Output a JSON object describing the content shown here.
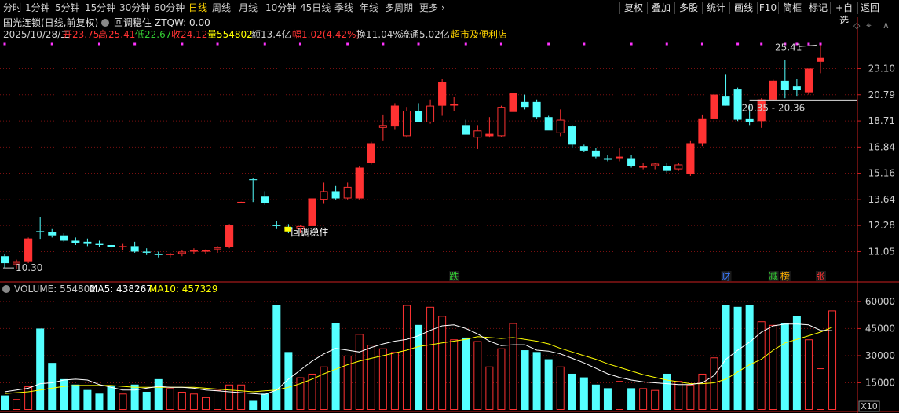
{
  "toolbar": {
    "periods": [
      "分时",
      "1分钟",
      "5分钟",
      "15分钟",
      "30分钟",
      "60分钟",
      "日线",
      "周线",
      "月线",
      "10分钟",
      "45日线",
      "季线",
      "年线",
      "多周期",
      "更多"
    ],
    "active_period": "日线",
    "more_arrow": "›",
    "right_buttons": [
      "复权",
      "叠加",
      "多股",
      "统计",
      "画线",
      "F10",
      "简框",
      "标记",
      "+自选",
      "返回"
    ]
  },
  "header": {
    "stock_title": "国光连锁(日线,前复权)",
    "indicator_name": "回调稳住",
    "indicator_value": "ZTQW: 0.00",
    "info": {
      "date": "2025/10/28/二",
      "open_label": "开",
      "open": "23.75",
      "high_label": "高",
      "high": "25.41",
      "low_label": "低",
      "low": "22.67",
      "close_label": "收",
      "close": "24.12",
      "volume_label": "量",
      "volume": "554802",
      "amount_label": "额",
      "amount": "13.4亿",
      "change_label": "幅",
      "change": "1.02(4.42%)",
      "turnover_label": "换",
      "turnover": "11.04%",
      "float_label": "流通",
      "float": "5.02亿",
      "sector": "超市及便利店"
    }
  },
  "colors": {
    "up": "#ff3232",
    "down": "#54ffff",
    "ma5": "#ffffff",
    "ma10": "#ffff00",
    "axis": "#cc2020",
    "text_axis": "#d0d0d0"
  },
  "chart_data": [
    {
      "type": "candlestick",
      "y_ticks": [
        "23.10",
        "20.79",
        "18.71",
        "16.84",
        "15.16",
        "13.64",
        "12.28",
        "11.05"
      ],
      "ylim": [
        10.0,
        25.6
      ],
      "log_scale": true,
      "candles": [
        {
          "o": 10.85,
          "h": 10.95,
          "l": 10.35,
          "c": 10.55
        },
        {
          "o": 10.5,
          "h": 10.7,
          "l": 10.3,
          "c": 10.6
        },
        {
          "o": 10.6,
          "h": 11.7,
          "l": 10.55,
          "c": 11.65
        },
        {
          "o": 12.0,
          "h": 12.7,
          "l": 11.6,
          "c": 11.95
        },
        {
          "o": 11.95,
          "h": 12.1,
          "l": 11.7,
          "c": 11.8
        },
        {
          "o": 11.8,
          "h": 11.9,
          "l": 11.5,
          "c": 11.55
        },
        {
          "o": 11.55,
          "h": 11.7,
          "l": 11.35,
          "c": 11.45
        },
        {
          "o": 11.5,
          "h": 11.65,
          "l": 11.3,
          "c": 11.4
        },
        {
          "o": 11.4,
          "h": 11.55,
          "l": 11.25,
          "c": 11.35
        },
        {
          "o": 11.35,
          "h": 11.45,
          "l": 11.15,
          "c": 11.25
        },
        {
          "o": 11.25,
          "h": 11.4,
          "l": 11.1,
          "c": 11.3
        },
        {
          "o": 11.3,
          "h": 11.5,
          "l": 11.0,
          "c": 11.05
        },
        {
          "o": 11.05,
          "h": 11.2,
          "l": 10.9,
          "c": 11.0
        },
        {
          "o": 10.95,
          "h": 11.05,
          "l": 10.8,
          "c": 10.9
        },
        {
          "o": 10.9,
          "h": 11.0,
          "l": 10.8,
          "c": 10.95
        },
        {
          "o": 10.95,
          "h": 11.1,
          "l": 10.85,
          "c": 11.05
        },
        {
          "o": 11.05,
          "h": 11.2,
          "l": 10.95,
          "c": 11.1
        },
        {
          "o": 11.05,
          "h": 11.15,
          "l": 10.95,
          "c": 11.1
        },
        {
          "o": 11.15,
          "h": 11.3,
          "l": 11.0,
          "c": 11.25
        },
        {
          "o": 11.25,
          "h": 12.35,
          "l": 11.2,
          "c": 12.3
        },
        {
          "o": 13.5,
          "h": 13.52,
          "l": 13.48,
          "c": 13.51
        },
        {
          "o": 14.8,
          "h": 14.85,
          "l": 13.5,
          "c": 14.75
        },
        {
          "o": 13.8,
          "h": 14.1,
          "l": 13.35,
          "c": 13.45
        },
        {
          "o": 12.3,
          "h": 12.5,
          "l": 12.1,
          "c": 12.25
        },
        {
          "o": 12.2,
          "h": 12.35,
          "l": 11.9,
          "c": 12.1
        },
        {
          "o": 12.1,
          "h": 12.3,
          "l": 11.9,
          "c": 12.25
        },
        {
          "o": 12.25,
          "h": 13.8,
          "l": 12.2,
          "c": 13.7
        },
        {
          "o": 13.6,
          "h": 14.6,
          "l": 13.4,
          "c": 14.1
        },
        {
          "o": 14.1,
          "h": 14.4,
          "l": 13.6,
          "c": 13.7
        },
        {
          "o": 13.7,
          "h": 14.6,
          "l": 13.6,
          "c": 14.35
        },
        {
          "o": 13.7,
          "h": 15.6,
          "l": 13.6,
          "c": 15.5
        },
        {
          "o": 15.8,
          "h": 17.2,
          "l": 15.7,
          "c": 17.1
        },
        {
          "o": 18.2,
          "h": 19.2,
          "l": 17.3,
          "c": 18.4
        },
        {
          "o": 18.3,
          "h": 20.1,
          "l": 18.1,
          "c": 19.9
        },
        {
          "o": 17.6,
          "h": 19.8,
          "l": 17.5,
          "c": 19.5
        },
        {
          "o": 19.5,
          "h": 20.1,
          "l": 18.6,
          "c": 18.6
        },
        {
          "o": 18.6,
          "h": 20.4,
          "l": 18.5,
          "c": 19.9
        },
        {
          "o": 19.9,
          "h": 22.2,
          "l": 19.1,
          "c": 21.9
        },
        {
          "o": 19.95,
          "h": 20.6,
          "l": 19.45,
          "c": 20.0
        },
        {
          "o": 18.4,
          "h": 18.8,
          "l": 17.7,
          "c": 17.7
        },
        {
          "o": 17.5,
          "h": 18.4,
          "l": 16.7,
          "c": 18.0
        },
        {
          "o": 17.6,
          "h": 19.0,
          "l": 17.5,
          "c": 17.75
        },
        {
          "o": 17.6,
          "h": 19.9,
          "l": 17.55,
          "c": 19.8
        },
        {
          "o": 19.4,
          "h": 21.6,
          "l": 19.3,
          "c": 20.9
        },
        {
          "o": 20.2,
          "h": 20.8,
          "l": 19.6,
          "c": 19.8
        },
        {
          "o": 20.2,
          "h": 20.4,
          "l": 18.9,
          "c": 19.0
        },
        {
          "o": 19.0,
          "h": 19.1,
          "l": 18.0,
          "c": 18.0
        },
        {
          "o": 17.8,
          "h": 19.6,
          "l": 17.6,
          "c": 18.8
        },
        {
          "o": 18.3,
          "h": 18.4,
          "l": 16.8,
          "c": 17.0
        },
        {
          "o": 16.9,
          "h": 17.0,
          "l": 16.5,
          "c": 16.6
        },
        {
          "o": 16.6,
          "h": 16.8,
          "l": 16.1,
          "c": 16.2
        },
        {
          "o": 16.1,
          "h": 16.3,
          "l": 15.9,
          "c": 16.0
        },
        {
          "o": 16.1,
          "h": 16.8,
          "l": 15.9,
          "c": 16.2
        },
        {
          "o": 16.1,
          "h": 16.3,
          "l": 15.5,
          "c": 15.6
        },
        {
          "o": 15.5,
          "h": 15.8,
          "l": 15.4,
          "c": 15.6
        },
        {
          "o": 15.6,
          "h": 15.8,
          "l": 15.4,
          "c": 15.75
        },
        {
          "o": 15.6,
          "h": 15.8,
          "l": 15.2,
          "c": 15.3
        },
        {
          "o": 15.4,
          "h": 15.8,
          "l": 15.3,
          "c": 15.7
        },
        {
          "o": 15.1,
          "h": 17.3,
          "l": 15.0,
          "c": 17.1
        },
        {
          "o": 17.1,
          "h": 19.2,
          "l": 16.9,
          "c": 18.9
        },
        {
          "o": 18.9,
          "h": 21.1,
          "l": 18.5,
          "c": 20.8
        },
        {
          "o": 20.7,
          "h": 22.6,
          "l": 20.6,
          "c": 19.9
        },
        {
          "o": 21.3,
          "h": 21.4,
          "l": 18.7,
          "c": 18.8
        },
        {
          "o": 18.9,
          "h": 19.9,
          "l": 18.4,
          "c": 18.6
        },
        {
          "o": 18.7,
          "h": 20.5,
          "l": 18.2,
          "c": 20.4
        },
        {
          "o": 20.4,
          "h": 22.1,
          "l": 20.3,
          "c": 22.0
        },
        {
          "o": 22.0,
          "h": 23.9,
          "l": 20.5,
          "c": 21.2
        },
        {
          "o": 21.5,
          "h": 22.2,
          "l": 20.7,
          "c": 21.2
        },
        {
          "o": 21.0,
          "h": 23.1,
          "l": 20.8,
          "c": 23.1
        },
        {
          "o": 23.75,
          "h": 25.41,
          "l": 22.67,
          "c": 24.12
        }
      ],
      "annotations": {
        "high_label": "25.41",
        "low_label": "10.30",
        "range_label": "20.35 - 20.36",
        "range_price": 20.36,
        "indicator_mark": "回调稳住",
        "indicator_mark_index": 24
      },
      "events": [
        {
          "index": 38,
          "label": "跌",
          "color": "#33cc33"
        },
        {
          "index": 61,
          "label": "财",
          "color": "#3b7bff"
        },
        {
          "index": 65,
          "label": "减",
          "color": "#33cc33"
        },
        {
          "index": 66,
          "label": "榜",
          "color": "#ffb000"
        },
        {
          "index": 69,
          "label": "张",
          "color": "#ff3232"
        }
      ],
      "signal_dots_indices": [
        0,
        4,
        8,
        11,
        15,
        18,
        22,
        25,
        29,
        32,
        35,
        39,
        42,
        46,
        49,
        53,
        56,
        59,
        62,
        64,
        66,
        67,
        68,
        69
      ]
    },
    {
      "type": "bar",
      "title": "VOLUME",
      "legend": [
        {
          "label": "VOLUME: 554802",
          "color": "#c8c8c8"
        },
        {
          "label": "MA5: 438267",
          "color": "#ffffff"
        },
        {
          "label": "MA10: 457329",
          "color": "#ffff00"
        }
      ],
      "y_ticks": [
        "60000",
        "45000",
        "30000",
        "15000"
      ],
      "ylim": [
        0,
        63000
      ],
      "multiplier_label": "X10",
      "values": [
        8000,
        6000,
        13000,
        45000,
        26000,
        17000,
        14000,
        11000,
        9000,
        13000,
        9000,
        14000,
        10000,
        17000,
        12000,
        10000,
        9000,
        7000,
        11000,
        14000,
        14000,
        5000,
        9000,
        58000,
        32000,
        18000,
        20000,
        24000,
        48000,
        30000,
        42000,
        36000,
        34000,
        32000,
        58000,
        47000,
        57000,
        52000,
        39000,
        40000,
        38000,
        24000,
        34000,
        48000,
        33000,
        32000,
        28000,
        24000,
        20000,
        18000,
        14000,
        12000,
        16000,
        12000,
        12000,
        11000,
        20000,
        16000,
        14000,
        20000,
        29000,
        58000,
        57000,
        58000,
        49000,
        47000,
        48000,
        52000,
        39000,
        23000,
        55000
      ],
      "ma5": [
        10000,
        11000,
        12000,
        14500,
        15000,
        16500,
        17000,
        16500,
        14000,
        12500,
        11000,
        11000,
        12000,
        13000,
        12500,
        12500,
        12000,
        11000,
        10500,
        10000,
        9500,
        9000,
        8500,
        11000,
        17000,
        22000,
        27000,
        31000,
        34000,
        33000,
        32000,
        34500,
        36500,
        38000,
        39000,
        41000,
        44000,
        46500,
        47000,
        45000,
        42000,
        38000,
        35500,
        36000,
        36000,
        33000,
        32500,
        31000,
        28500,
        26000,
        23000,
        20000,
        18000,
        16500,
        15500,
        15000,
        14500,
        14000,
        14000,
        15000,
        19000,
        28000,
        33000,
        37500,
        43000,
        46500,
        47500,
        47500,
        47000,
        44000,
        43826
      ],
      "ma10": [
        9000,
        9500,
        10000,
        11000,
        12000,
        13000,
        13500,
        13500,
        13500,
        13500,
        13000,
        12500,
        12500,
        12500,
        12500,
        12500,
        12500,
        12000,
        11500,
        11000,
        10500,
        10000,
        10500,
        11000,
        12500,
        14500,
        17000,
        20000,
        22500,
        25000,
        27000,
        28500,
        30000,
        31500,
        33000,
        35000,
        36000,
        37000,
        38000,
        39000,
        40500,
        40000,
        39500,
        40000,
        39000,
        38000,
        36500,
        34000,
        32000,
        30000,
        28000,
        25500,
        23500,
        21500,
        19500,
        18000,
        16500,
        15500,
        14500,
        14500,
        15000,
        17000,
        21000,
        25000,
        28000,
        33000,
        37000,
        39000,
        41000,
        43000,
        45733
      ]
    }
  ]
}
